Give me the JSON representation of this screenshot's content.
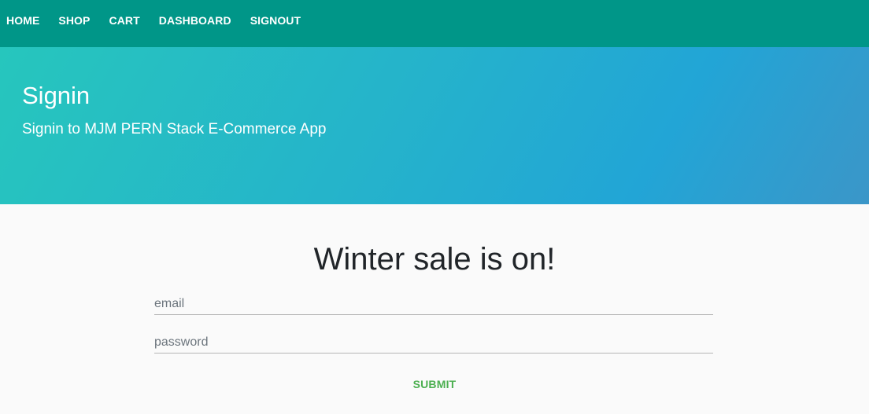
{
  "nav": {
    "items": [
      {
        "label": "HOME"
      },
      {
        "label": "SHOP"
      },
      {
        "label": "CART"
      },
      {
        "label": "DASHBOARD"
      },
      {
        "label": "SIGNOUT"
      }
    ],
    "background": "#009688"
  },
  "hero": {
    "title": "Signin",
    "subtitle": "Signin to MJM PERN Stack E-Commerce App"
  },
  "main": {
    "banner": "Winter sale is on!",
    "form": {
      "email_placeholder": "email",
      "email_value": "",
      "password_placeholder": "password",
      "password_value": "",
      "submit_label": "SUBMIT",
      "submit_color": "#4caf50"
    }
  }
}
